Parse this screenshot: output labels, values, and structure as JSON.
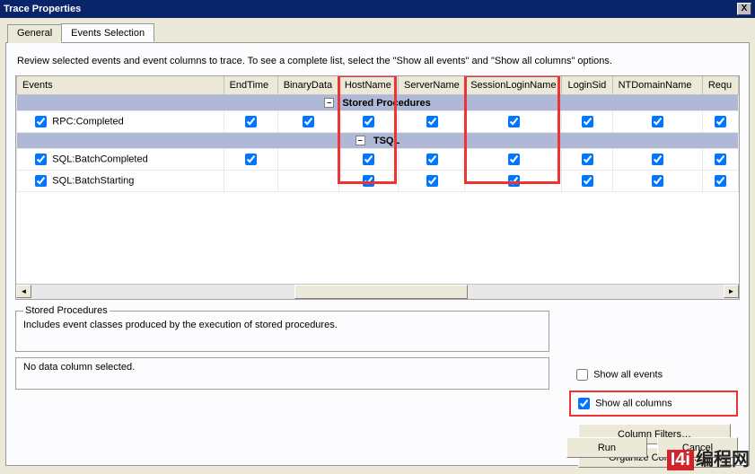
{
  "window": {
    "title": "Trace Properties",
    "close": "X"
  },
  "tabs": {
    "general": "General",
    "events": "Events Selection"
  },
  "description": "Review selected events and event columns to trace. To see a complete list, select the \"Show all events\" and \"Show all columns\" options.",
  "columns": {
    "c0": "Events",
    "c1": "EndTime",
    "c2": "BinaryData",
    "c3": "HostName",
    "c4": "ServerName",
    "c5": "SessionLoginName",
    "c6": "LoginSid",
    "c7": "NTDomainName",
    "c8": "Requ"
  },
  "cats": {
    "sp": "Stored Procedures",
    "tsql": "TSQL"
  },
  "rows": {
    "rpc": "RPC:Completed",
    "batchc": "SQL:BatchCompleted",
    "batchs": "SQL:BatchStarting"
  },
  "fieldsets": {
    "info_legend": "Stored Procedures",
    "info_text": "Includes event classes produced by the execution of stored procedures.",
    "nodata": "No data column selected."
  },
  "checks": {
    "show_events": "Show all events",
    "show_columns": "Show all columns"
  },
  "buttons": {
    "filters": "Column Filters…",
    "organize": "Organize Columns…",
    "run": "Run",
    "cancel": "Cancel"
  },
  "toggle": "–",
  "scroll": {
    "left": "◄",
    "right": "►"
  },
  "watermark": {
    "logo": "I4i",
    "text": "编程网"
  }
}
